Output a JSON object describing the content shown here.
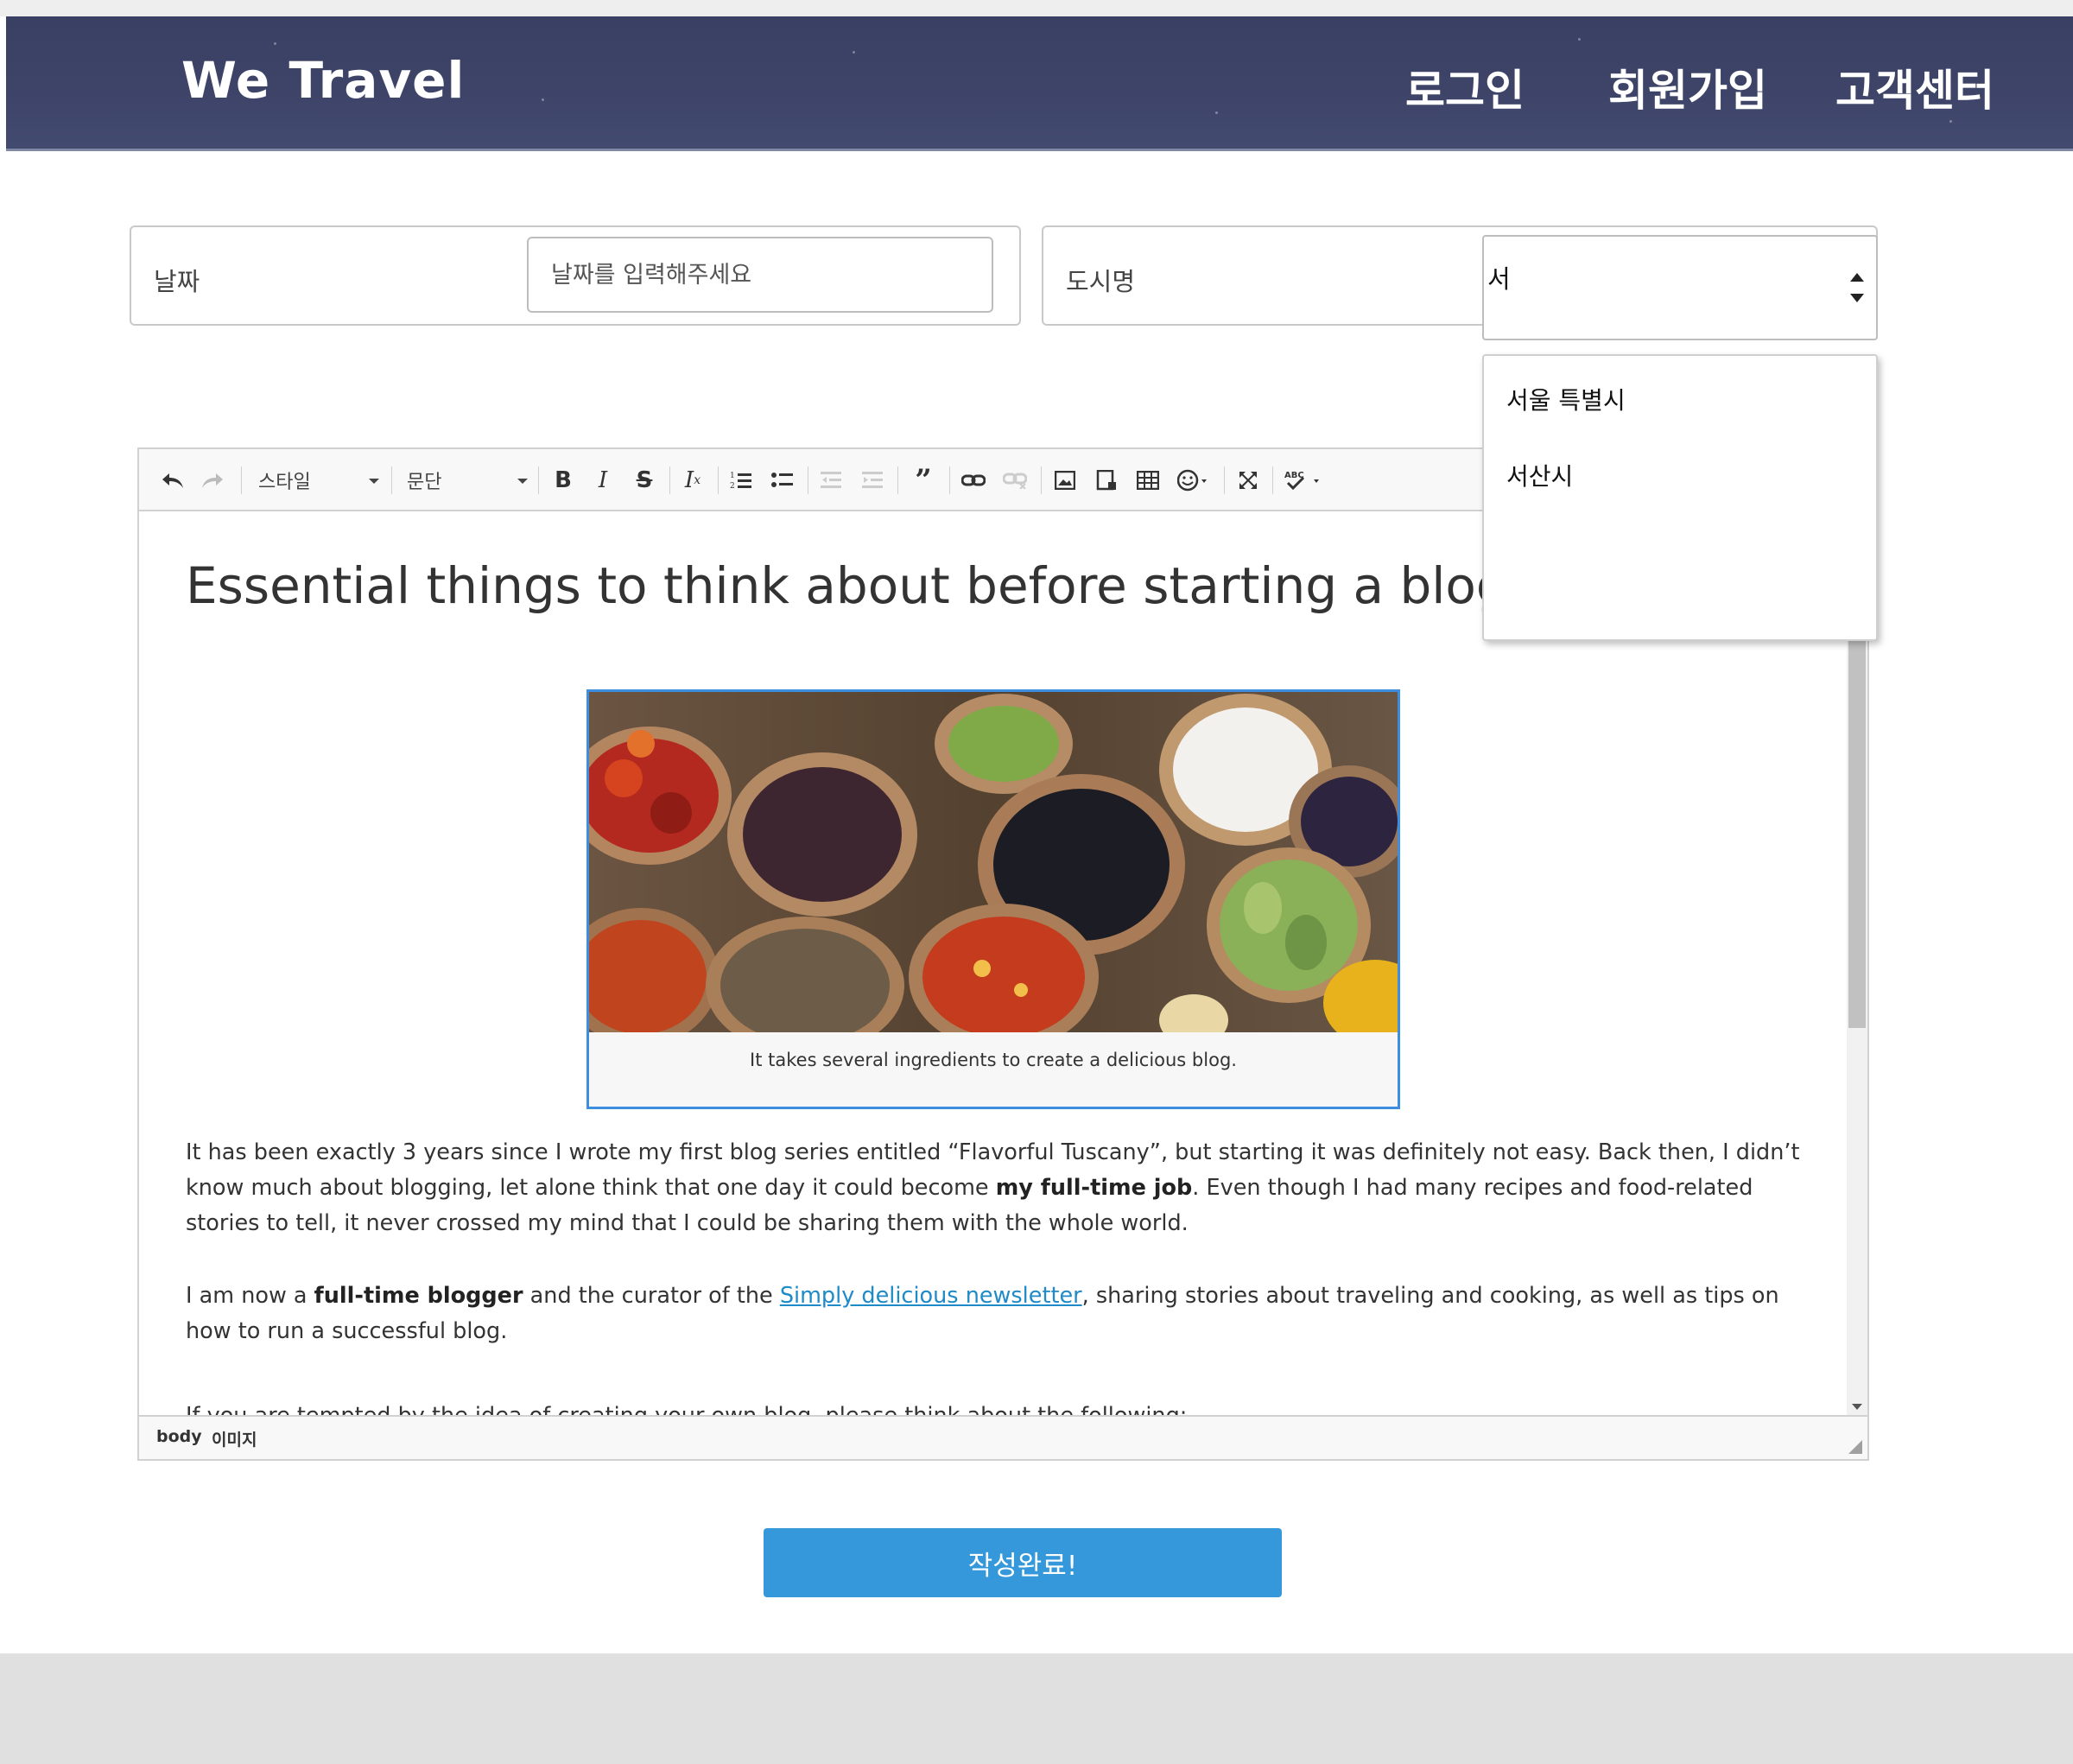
{
  "header": {
    "logo": "We Travel",
    "nav": [
      "로그인",
      "회원가입",
      "고객센터"
    ]
  },
  "form": {
    "date_label": "날짜",
    "date_placeholder": "날짜를 입력해주세요",
    "city_label": "도시명",
    "city_value": "서",
    "city_options": [
      "서울 특별시",
      "서산시"
    ]
  },
  "editor": {
    "toolbar": {
      "style_combo": "스타일",
      "format_combo": "문단",
      "icons": [
        "undo-icon",
        "redo-icon",
        "bold-icon",
        "italic-icon",
        "strike-icon",
        "remove-format-icon",
        "numbered-list-icon",
        "bulleted-list-icon",
        "outdent-icon",
        "indent-icon",
        "blockquote-icon",
        "link-icon",
        "unlink-icon",
        "image-icon",
        "embed-icon",
        "table-icon",
        "emoji-icon",
        "maximize-icon",
        "spellcheck-icon"
      ]
    },
    "title": "Essential things to think about before starting a blog",
    "caption": "It takes several ingredients to create a delicious blog.",
    "p1_a": "It has been exactly 3 years since I wrote my first blog series entitled “Flavorful Tuscany”, but starting it was definitely not easy. Back then, I didn’t know much about blogging, let alone think that one day it could become ",
    "p1_bold": "my full-time job",
    "p1_b": ". Even though I had many recipes and food-related stories to tell, it never crossed my mind that I could be sharing them with the whole world.",
    "p2_a": "I am now a ",
    "p2_bold": "full-time blogger",
    "p2_b": " and the curator of the ",
    "p2_link": "Simply delicious newsletter",
    "p2_c": ", sharing stories about traveling and cooking, as well as tips on how to run a successful blog.",
    "p3": "If you are tempted by the idea of creating your own blog, please think about the following:",
    "path": [
      "body",
      "이미지"
    ]
  },
  "submit_label": "작성완료!"
}
